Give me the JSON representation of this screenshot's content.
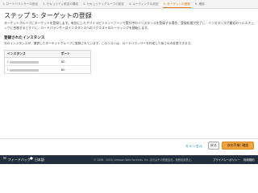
{
  "wizard": {
    "steps": [
      {
        "label": "1. ロードバランサーの設定"
      },
      {
        "label": "2. セキュリティ設定の構成"
      },
      {
        "label": "3. セキュリティグループの設定"
      },
      {
        "label": "4. ルーティングの設定"
      },
      {
        "label": "5. ターゲットの登録"
      },
      {
        "label": "6. 確認"
      }
    ],
    "active_index": 4
  },
  "page": {
    "title": "ステップ 5: ターゲットの登録",
    "description": "ターゲットグループにターゲットを登録します。有効にしたアベイラビリティーゾーンで実行中のインスタンスを登録する場合、登録処理が完了し、インスタンスが最初のヘルスチェックに合格するとすぐに、ロードバランサーはインスタンスへのリクエストのルーティングを開始します。"
  },
  "registered": {
    "title": "登録されたインスタンス",
    "description": "次のインスタンスが、選択したターゲットグループに登録されています。このリストは、ロードバランサーを作成した後でのみ変更できます。",
    "headers": {
      "instance": "インスタンス",
      "port": "ポート"
    },
    "rows": [
      {
        "instance_prefix": "i-",
        "port": "80"
      },
      {
        "instance_prefix": "i-",
        "port": "80"
      }
    ]
  },
  "footer": {
    "cancel": "キャンセル",
    "back": "戻る",
    "next": "次の手順: 確認"
  },
  "bottom_bar": {
    "feedback": "フィードバック",
    "language": "日本語",
    "copyright": "© 2008 - 2018, Amazon Web Services, Inc. またはその関連会社。無断転用禁止。",
    "privacy": "プライバシーポリシー",
    "terms": "利用規約"
  },
  "colors": {
    "accent": "#e47911",
    "primary_button": "#f0a43b",
    "link": "#0073bb",
    "bottom_bar": "#232f3e"
  }
}
